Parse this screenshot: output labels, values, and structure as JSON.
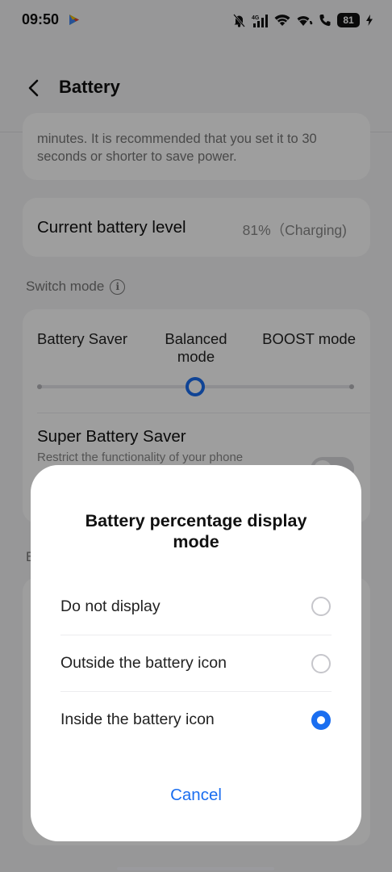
{
  "status_bar": {
    "time": "09:50",
    "battery_level": "81",
    "icons": [
      "play-store-icon",
      "silent-bell-icon",
      "cellular-4g-icon",
      "wifi-icon",
      "wifi-calling-icon",
      "battery-icon",
      "charging-bolt-icon"
    ]
  },
  "header": {
    "title": "Battery",
    "back_icon": "chevron-left-icon"
  },
  "screen_timeout_card": {
    "description": "minutes. It is recommended that you set it to 30 seconds or shorter to save power."
  },
  "battery_level_card": {
    "label": "Current battery level",
    "value": "81%（Charging)"
  },
  "switch_mode": {
    "section_label": "Switch mode",
    "info_icon": "info-icon",
    "options": [
      "Battery Saver",
      "Balanced mode",
      "BOOST mode"
    ],
    "selected": "Balanced mode",
    "super_saver_title": "Super Battery Saver",
    "super_saver_subtitle": "Restrict the functionality of your phone",
    "super_saver_enabled": false
  },
  "section_b_initial": "B",
  "dialog": {
    "title": "Battery percentage display mode",
    "options": [
      {
        "label": "Do not display",
        "selected": false
      },
      {
        "label": "Outside the battery icon",
        "selected": false
      },
      {
        "label": "Inside the battery icon",
        "selected": true
      }
    ],
    "cancel_label": "Cancel"
  },
  "colors": {
    "accent": "#1a6ef0",
    "background": "#f4f4f6",
    "card": "#ffffff",
    "scrim": "rgba(0,0,0,0.38)"
  }
}
